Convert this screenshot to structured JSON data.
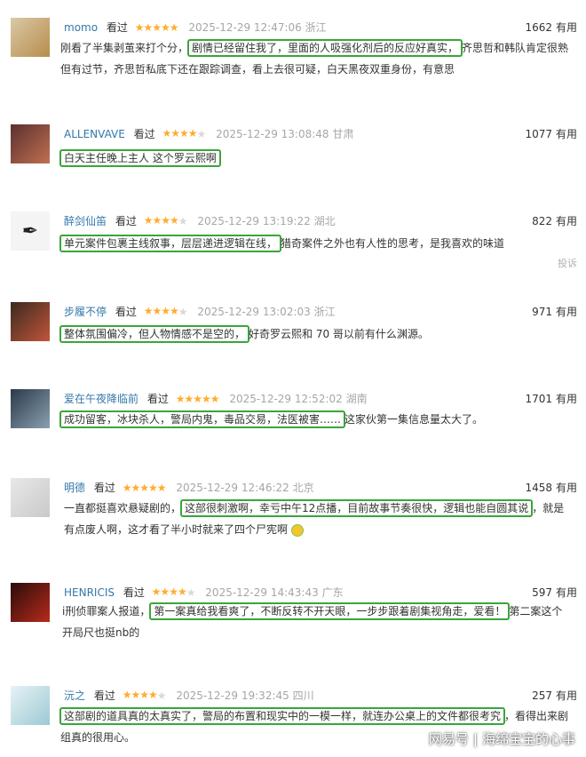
{
  "reviews": [
    {
      "user": "momo",
      "watched": "看过",
      "stars": 5,
      "date": "2025-12-29 12:47:06",
      "location": "浙江",
      "useful_count": "1662",
      "useful_label": "有用",
      "lines": [
        {
          "pre": "刚看了半集剥茧来打个分，",
          "hl": "剧情已经留住我了，里面的人吸强化剂后的反应好真实，",
          "post": "齐思哲和韩队肯定很熟"
        },
        {
          "pre": "但有过节，齐思哲私底下还在跟踪调查，看上去很可疑，白天黑夜双重身份，有意思",
          "hl": "",
          "post": ""
        }
      ]
    },
    {
      "user": "ALLENVAVE",
      "watched": "看过",
      "stars": 4,
      "date": "2025-12-29 13:08:48",
      "location": "甘肃",
      "useful_count": "1077",
      "useful_label": "有用",
      "lines": [
        {
          "pre": "",
          "hl": "白天主任晚上主人 这个罗云熙啊",
          "post": ""
        }
      ]
    },
    {
      "user": "醉剑仙笛",
      "watched": "看过",
      "stars": 4,
      "date": "2025-12-29 13:19:22",
      "location": "湖北",
      "useful_count": "822",
      "useful_label": "有用",
      "lines": [
        {
          "pre": "",
          "hl": "单元案件包裹主线叙事，层层递进逻辑在线，",
          "post": "猎奇案件之外也有人性的思考，是我喜欢的味道"
        }
      ],
      "report": "投诉"
    },
    {
      "user": "步履不停",
      "watched": "看过",
      "stars": 4,
      "date": "2025-12-29 13:02:03",
      "location": "浙江",
      "useful_count": "971",
      "useful_label": "有用",
      "lines": [
        {
          "pre": "",
          "hl": "整体氛围偏冷，但人物情感不是空的，",
          "post": "好奇罗云熙和 70 哥以前有什么渊源。"
        }
      ]
    },
    {
      "user": "爱在午夜降临前",
      "watched": "看过",
      "stars": 5,
      "date": "2025-12-29 12:52:02",
      "location": "湖南",
      "useful_count": "1701",
      "useful_label": "有用",
      "lines": [
        {
          "pre": "",
          "hl": "成功留客，冰块杀人，警局内鬼，毒品交易，法医被害……",
          "post": "这家伙第一集信息量太大了。"
        }
      ]
    },
    {
      "user": "明德",
      "watched": "看过",
      "stars": 5,
      "date": "2025-12-29 12:46:22",
      "location": "北京",
      "useful_count": "1458",
      "useful_label": "有用",
      "lines": [
        {
          "pre": "一直都挺喜欢悬疑剧的，",
          "hl": "这部很刺激啊，幸亏中午12点播，目前故事节奏很快，逻辑也能自圆其说",
          "post": "，就是"
        },
        {
          "pre": "有点废人啊，这才看了半小时就来了四个尸宪啊",
          "hl": "",
          "post": ""
        }
      ]
    },
    {
      "user": "HENRICIS",
      "watched": "看过",
      "stars": 4,
      "date": "2025-12-29 14:43:43",
      "location": "广东",
      "useful_count": "597",
      "useful_label": "有用",
      "lines": [
        {
          "pre": "i刑侦罪案人报道，",
          "hl": "第一案真给我看爽了，不断反转不开天眼，一步步跟着剧集视角走，爱看！",
          "post": "第二案这个"
        },
        {
          "pre": "开局尺也挺nb的",
          "hl": "",
          "post": ""
        }
      ]
    },
    {
      "user": "沅之",
      "watched": "看过",
      "stars": 4,
      "date": "2025-12-29 19:32:45",
      "location": "四川",
      "useful_count": "257",
      "useful_label": "有用",
      "lines": [
        {
          "pre": "",
          "hl": "这部剧的道具真的太真实了，警局的布置和现实中的一模一样，就连办公桌上的文件都很考究",
          "post": "，看得出来剧"
        },
        {
          "pre": "组真的很用心。",
          "hl": "",
          "post": ""
        }
      ]
    }
  ],
  "footer": {
    "brand": "网易号",
    "author": "海绵宝宝的心事"
  },
  "colors": {
    "highlight": "#3aa53a",
    "star": "#ffac2d",
    "username": "#3377aa"
  }
}
